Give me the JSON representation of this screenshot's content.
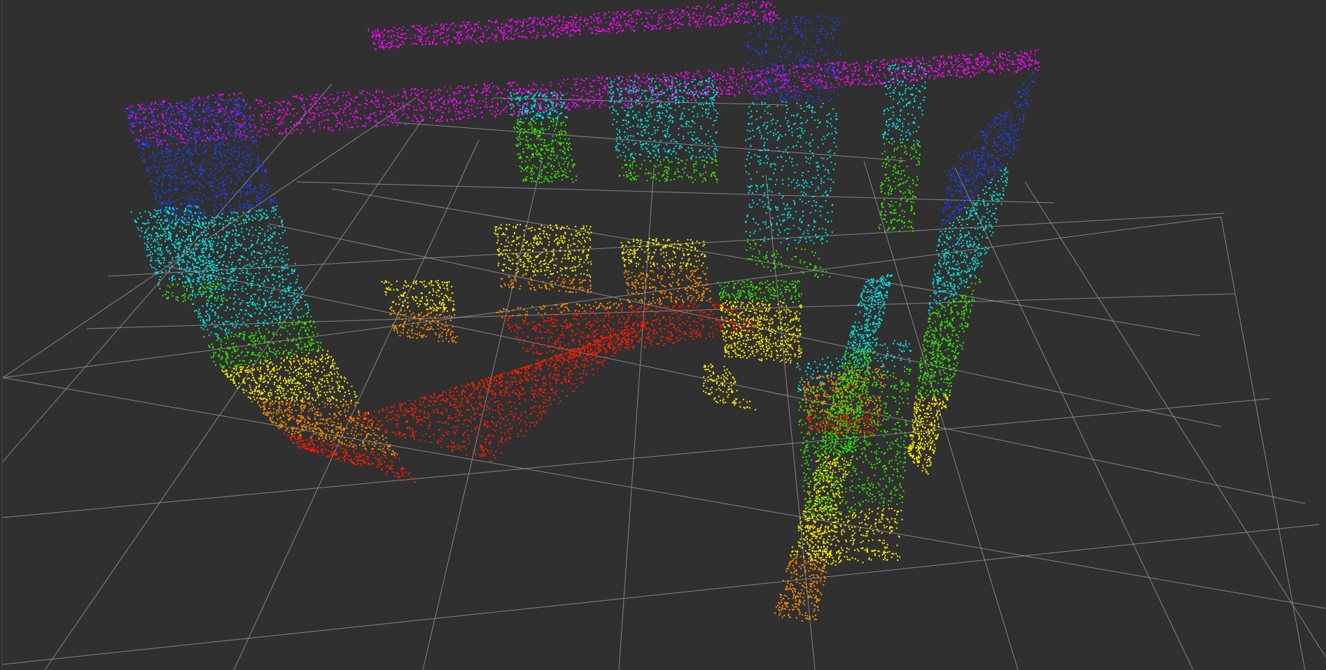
{
  "viewport": {
    "kind": "3d-view",
    "background_color": "#303030",
    "grid": {
      "visible": true,
      "color": "#a0a0a0"
    },
    "point_cloud": {
      "color_mode": "height-rainbow",
      "colormap": [
        "#ff1a00",
        "#ff8a00",
        "#ffee00",
        "#33e600",
        "#00e6e6",
        "#1f3cff",
        "#ff00ff"
      ]
    }
  }
}
